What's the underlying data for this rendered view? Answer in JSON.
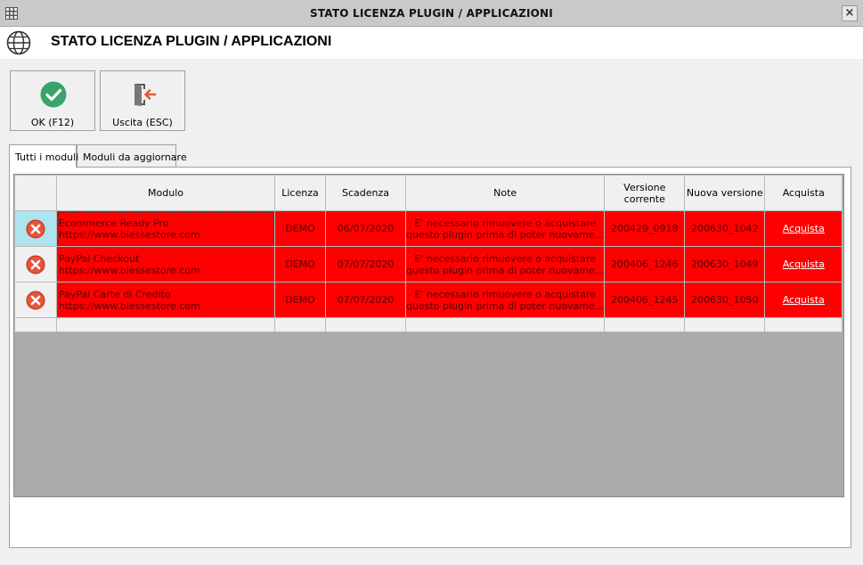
{
  "window": {
    "title": "STATO LICENZA PLUGIN / APPLICAZIONI",
    "close_glyph": "×",
    "icon": "app-grid-icon"
  },
  "header": {
    "title": "STATO LICENZA PLUGIN / APPLICAZIONI",
    "icon": "globe-icon"
  },
  "toolbar": {
    "ok_label": "OK (F12)",
    "ok_icon": "check-circle-icon",
    "ok_color": "#3aa36b",
    "exit_label": "Uscita (ESC)",
    "exit_icon": "exit-door-icon",
    "exit_color": "#e05a3a"
  },
  "tabs": [
    {
      "label": "Tutti i moduli",
      "active": true
    },
    {
      "label": "Moduli da aggiornare",
      "active": false
    }
  ],
  "grid": {
    "columns": [
      "Modulo",
      "Licenza",
      "Scadenza",
      "Note",
      "Versione corrente",
      "Nuova versione",
      "Acquista"
    ],
    "column_versione_line1": "Versione",
    "column_versione_line2": "corrente",
    "row_color": "#ff0000",
    "rows": [
      {
        "status_icon": "error-x-icon",
        "name": "Ecommerce Ready Pro",
        "url": "https://www.biessestore.com",
        "licenza": "DEMO",
        "scadenza": "06/07/2020",
        "note1": "E' necessario rimuovere o acquistare",
        "note2": "questo plugin prima di poter nuovame...",
        "versione": "200429_0918",
        "nuova": "200630_1042",
        "acquista": "Acquista"
      },
      {
        "status_icon": "error-x-icon",
        "name": "PayPal Checkout",
        "url": "https://www.biessestore.com",
        "licenza": "DEMO",
        "scadenza": "07/07/2020",
        "note1": "E' necessario rimuovere o acquistare",
        "note2": "questo plugin prima di poter nuovame...",
        "versione": "200406_1246",
        "nuova": "200630_1049",
        "acquista": "Acquista"
      },
      {
        "status_icon": "error-x-icon",
        "name": "PayPal Carte di Credito",
        "url": "https://www.biessestore.com",
        "licenza": "DEMO",
        "scadenza": "07/07/2020",
        "note1": "E' necessario rimuovere o acquistare",
        "note2": "questo plugin prima di poter nuovame...",
        "versione": "200406_1245",
        "nuova": "200630_1050",
        "acquista": "Acquista"
      }
    ]
  }
}
